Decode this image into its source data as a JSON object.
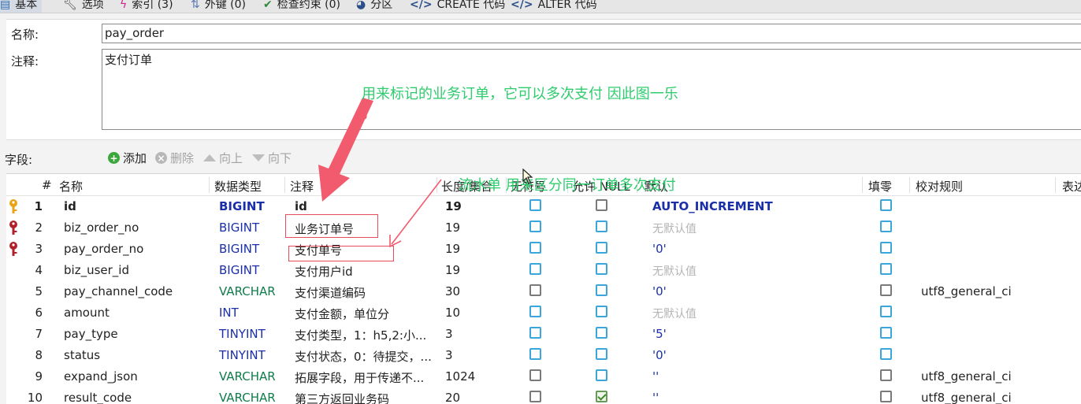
{
  "tabs": [
    {
      "label": "基本",
      "icon": "table-icon"
    },
    {
      "label": "选项",
      "icon": "wrench-icon"
    },
    {
      "label": "索引 (3)",
      "icon": "lightning-icon"
    },
    {
      "label": "外键 (0)",
      "icon": "foreign-key-icon"
    },
    {
      "label": "检查约束 (0)",
      "icon": "check-icon"
    },
    {
      "label": "分区",
      "icon": "partition-icon"
    },
    {
      "label": "CREATE 代码",
      "icon": "code-icon"
    },
    {
      "label": "ALTER 代码",
      "icon": "code-icon"
    }
  ],
  "props": {
    "name_label": "名称:",
    "name_value": "pay_order",
    "comment_label": "注释:",
    "comment_value": "支付订单"
  },
  "fieldbar": {
    "label": "字段:",
    "add": "添加",
    "delete": "删除",
    "up": "向上",
    "down": "向下"
  },
  "grid": {
    "headers": [
      "#",
      "名称",
      "数据类型",
      "注释",
      "长度/集合",
      "无符号",
      "允许 NULL",
      "默认",
      "填零",
      "校对规则",
      "表达"
    ],
    "rows": [
      {
        "num": "1",
        "name": "id",
        "type": "BIGINT",
        "comment": "id",
        "length": "19",
        "unsigned": false,
        "nullable": false,
        "default": "AUTO_INCREMENT",
        "zerofill": false,
        "collation": "",
        "key": "primary",
        "type_color": "#1a2fa8",
        "bold": true,
        "default_muted": false
      },
      {
        "num": "2",
        "name": "biz_order_no",
        "type": "BIGINT",
        "comment": "业务订单号",
        "length": "19",
        "unsigned": false,
        "nullable": false,
        "default": "无默认值",
        "zerofill": false,
        "collation": "",
        "key": "unique",
        "type_color": "#1a2fa8",
        "bold": false,
        "default_muted": true
      },
      {
        "num": "3",
        "name": "pay_order_no",
        "type": "BIGINT",
        "comment": "支付单号",
        "length": "19",
        "unsigned": false,
        "nullable": false,
        "default": "'0'",
        "zerofill": false,
        "collation": "",
        "key": "unique",
        "type_color": "#1a2fa8",
        "bold": false,
        "default_muted": false
      },
      {
        "num": "4",
        "name": "biz_user_id",
        "type": "BIGINT",
        "comment": "支付用户id",
        "length": "19",
        "unsigned": false,
        "nullable": false,
        "default": "无默认值",
        "zerofill": false,
        "collation": "",
        "key": "",
        "type_color": "#1a2fa8",
        "bold": false,
        "default_muted": true
      },
      {
        "num": "5",
        "name": "pay_channel_code",
        "type": "VARCHAR",
        "comment": "支付渠道编码",
        "length": "30",
        "unsigned": null,
        "nullable": false,
        "default": "'0'",
        "zerofill": null,
        "collation": "utf8_general_ci",
        "key": "",
        "type_color": "#0e7c4a",
        "bold": false,
        "default_muted": false
      },
      {
        "num": "6",
        "name": "amount",
        "type": "INT",
        "comment": "支付金额，单位分",
        "length": "10",
        "unsigned": false,
        "nullable": false,
        "default": "无默认值",
        "zerofill": false,
        "collation": "",
        "key": "",
        "type_color": "#1a2fa8",
        "bold": false,
        "default_muted": true
      },
      {
        "num": "7",
        "name": "pay_type",
        "type": "TINYINT",
        "comment": "支付类型，1：h5,2:小...",
        "length": "3",
        "unsigned": false,
        "nullable": false,
        "default": "'5'",
        "zerofill": false,
        "collation": "",
        "key": "",
        "type_color": "#1a2fa8",
        "bold": false,
        "default_muted": false
      },
      {
        "num": "8",
        "name": "status",
        "type": "TINYINT",
        "comment": "支付状态，0：待提交，...",
        "length": "3",
        "unsigned": false,
        "nullable": false,
        "default": "'0'",
        "zerofill": false,
        "collation": "",
        "key": "",
        "type_color": "#1a2fa8",
        "bold": false,
        "default_muted": false
      },
      {
        "num": "9",
        "name": "expand_json",
        "type": "VARCHAR",
        "comment": "拓展字段，用于传递不...",
        "length": "1024",
        "unsigned": null,
        "nullable": false,
        "default": "''",
        "zerofill": null,
        "collation": "utf8_general_ci",
        "key": "",
        "type_color": "#0e7c4a",
        "bold": false,
        "default_muted": false
      },
      {
        "num": "10",
        "name": "result_code",
        "type": "VARCHAR",
        "comment": "第三方返回业务码",
        "length": "20",
        "unsigned": null,
        "nullable": true,
        "default": "''",
        "zerofill": null,
        "collation": "utf8_general_ci",
        "key": "",
        "type_color": "#0e7c4a",
        "bold": false,
        "default_muted": false
      }
    ]
  },
  "annotations": {
    "note1": "用来标记的业务订单，它可以多次支付 因此图一乐",
    "note2": "流水单 用来区分同一订单多次支付"
  },
  "colors": {
    "annotation_text": "#2fcc6e",
    "arrow": "#f25a6e",
    "key_primary": "#e8a317",
    "key_unique": "#b0202a",
    "checkbox_blue": "#3aa6dc"
  }
}
